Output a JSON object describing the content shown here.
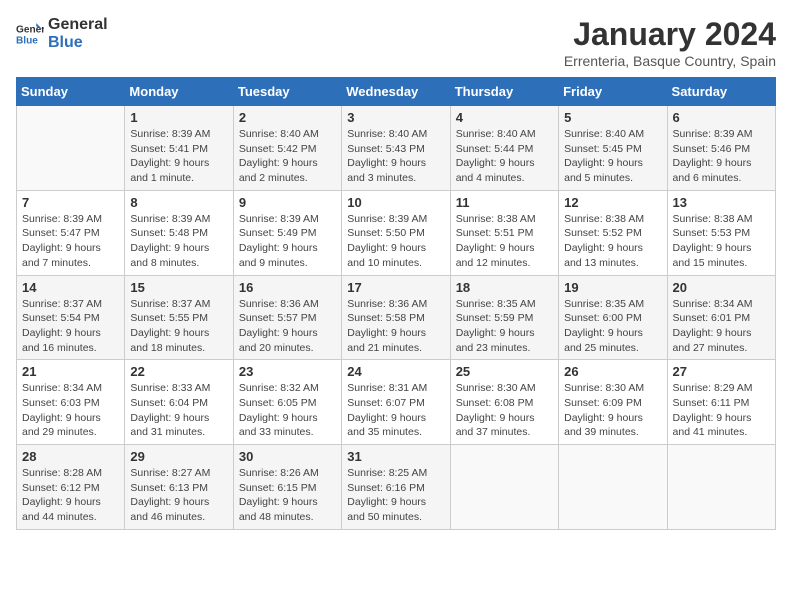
{
  "header": {
    "logo": {
      "text_general": "General",
      "text_blue": "Blue"
    },
    "title": "January 2024",
    "subtitle": "Errenteria, Basque Country, Spain"
  },
  "weekdays": [
    "Sunday",
    "Monday",
    "Tuesday",
    "Wednesday",
    "Thursday",
    "Friday",
    "Saturday"
  ],
  "weeks": [
    [
      {
        "day": "",
        "info": ""
      },
      {
        "day": "1",
        "info": "Sunrise: 8:39 AM\nSunset: 5:41 PM\nDaylight: 9 hours\nand 1 minute."
      },
      {
        "day": "2",
        "info": "Sunrise: 8:40 AM\nSunset: 5:42 PM\nDaylight: 9 hours\nand 2 minutes."
      },
      {
        "day": "3",
        "info": "Sunrise: 8:40 AM\nSunset: 5:43 PM\nDaylight: 9 hours\nand 3 minutes."
      },
      {
        "day": "4",
        "info": "Sunrise: 8:40 AM\nSunset: 5:44 PM\nDaylight: 9 hours\nand 4 minutes."
      },
      {
        "day": "5",
        "info": "Sunrise: 8:40 AM\nSunset: 5:45 PM\nDaylight: 9 hours\nand 5 minutes."
      },
      {
        "day": "6",
        "info": "Sunrise: 8:39 AM\nSunset: 5:46 PM\nDaylight: 9 hours\nand 6 minutes."
      }
    ],
    [
      {
        "day": "7",
        "info": "Sunrise: 8:39 AM\nSunset: 5:47 PM\nDaylight: 9 hours\nand 7 minutes."
      },
      {
        "day": "8",
        "info": "Sunrise: 8:39 AM\nSunset: 5:48 PM\nDaylight: 9 hours\nand 8 minutes."
      },
      {
        "day": "9",
        "info": "Sunrise: 8:39 AM\nSunset: 5:49 PM\nDaylight: 9 hours\nand 9 minutes."
      },
      {
        "day": "10",
        "info": "Sunrise: 8:39 AM\nSunset: 5:50 PM\nDaylight: 9 hours\nand 10 minutes."
      },
      {
        "day": "11",
        "info": "Sunrise: 8:38 AM\nSunset: 5:51 PM\nDaylight: 9 hours\nand 12 minutes."
      },
      {
        "day": "12",
        "info": "Sunrise: 8:38 AM\nSunset: 5:52 PM\nDaylight: 9 hours\nand 13 minutes."
      },
      {
        "day": "13",
        "info": "Sunrise: 8:38 AM\nSunset: 5:53 PM\nDaylight: 9 hours\nand 15 minutes."
      }
    ],
    [
      {
        "day": "14",
        "info": "Sunrise: 8:37 AM\nSunset: 5:54 PM\nDaylight: 9 hours\nand 16 minutes."
      },
      {
        "day": "15",
        "info": "Sunrise: 8:37 AM\nSunset: 5:55 PM\nDaylight: 9 hours\nand 18 minutes."
      },
      {
        "day": "16",
        "info": "Sunrise: 8:36 AM\nSunset: 5:57 PM\nDaylight: 9 hours\nand 20 minutes."
      },
      {
        "day": "17",
        "info": "Sunrise: 8:36 AM\nSunset: 5:58 PM\nDaylight: 9 hours\nand 21 minutes."
      },
      {
        "day": "18",
        "info": "Sunrise: 8:35 AM\nSunset: 5:59 PM\nDaylight: 9 hours\nand 23 minutes."
      },
      {
        "day": "19",
        "info": "Sunrise: 8:35 AM\nSunset: 6:00 PM\nDaylight: 9 hours\nand 25 minutes."
      },
      {
        "day": "20",
        "info": "Sunrise: 8:34 AM\nSunset: 6:01 PM\nDaylight: 9 hours\nand 27 minutes."
      }
    ],
    [
      {
        "day": "21",
        "info": "Sunrise: 8:34 AM\nSunset: 6:03 PM\nDaylight: 9 hours\nand 29 minutes."
      },
      {
        "day": "22",
        "info": "Sunrise: 8:33 AM\nSunset: 6:04 PM\nDaylight: 9 hours\nand 31 minutes."
      },
      {
        "day": "23",
        "info": "Sunrise: 8:32 AM\nSunset: 6:05 PM\nDaylight: 9 hours\nand 33 minutes."
      },
      {
        "day": "24",
        "info": "Sunrise: 8:31 AM\nSunset: 6:07 PM\nDaylight: 9 hours\nand 35 minutes."
      },
      {
        "day": "25",
        "info": "Sunrise: 8:30 AM\nSunset: 6:08 PM\nDaylight: 9 hours\nand 37 minutes."
      },
      {
        "day": "26",
        "info": "Sunrise: 8:30 AM\nSunset: 6:09 PM\nDaylight: 9 hours\nand 39 minutes."
      },
      {
        "day": "27",
        "info": "Sunrise: 8:29 AM\nSunset: 6:11 PM\nDaylight: 9 hours\nand 41 minutes."
      }
    ],
    [
      {
        "day": "28",
        "info": "Sunrise: 8:28 AM\nSunset: 6:12 PM\nDaylight: 9 hours\nand 44 minutes."
      },
      {
        "day": "29",
        "info": "Sunrise: 8:27 AM\nSunset: 6:13 PM\nDaylight: 9 hours\nand 46 minutes."
      },
      {
        "day": "30",
        "info": "Sunrise: 8:26 AM\nSunset: 6:15 PM\nDaylight: 9 hours\nand 48 minutes."
      },
      {
        "day": "31",
        "info": "Sunrise: 8:25 AM\nSunset: 6:16 PM\nDaylight: 9 hours\nand 50 minutes."
      },
      {
        "day": "",
        "info": ""
      },
      {
        "day": "",
        "info": ""
      },
      {
        "day": "",
        "info": ""
      }
    ]
  ]
}
